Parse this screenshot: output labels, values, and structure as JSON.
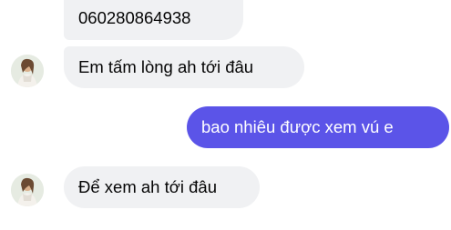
{
  "messages": [
    {
      "sender": "other",
      "text": "060280864938"
    },
    {
      "sender": "other",
      "text": "Em tấm lòng ah tới đâu"
    },
    {
      "sender": "self",
      "text": "bao nhiêu được xem vú e"
    },
    {
      "sender": "other",
      "text": "Để xem ah tới đâu"
    }
  ],
  "colors": {
    "incoming_bubble": "#f0f1f3",
    "outgoing_bubble": "#5b54e8",
    "outgoing_text": "#ffffff",
    "incoming_text": "#050505"
  },
  "icons": {
    "avatar": "contact-avatar"
  }
}
